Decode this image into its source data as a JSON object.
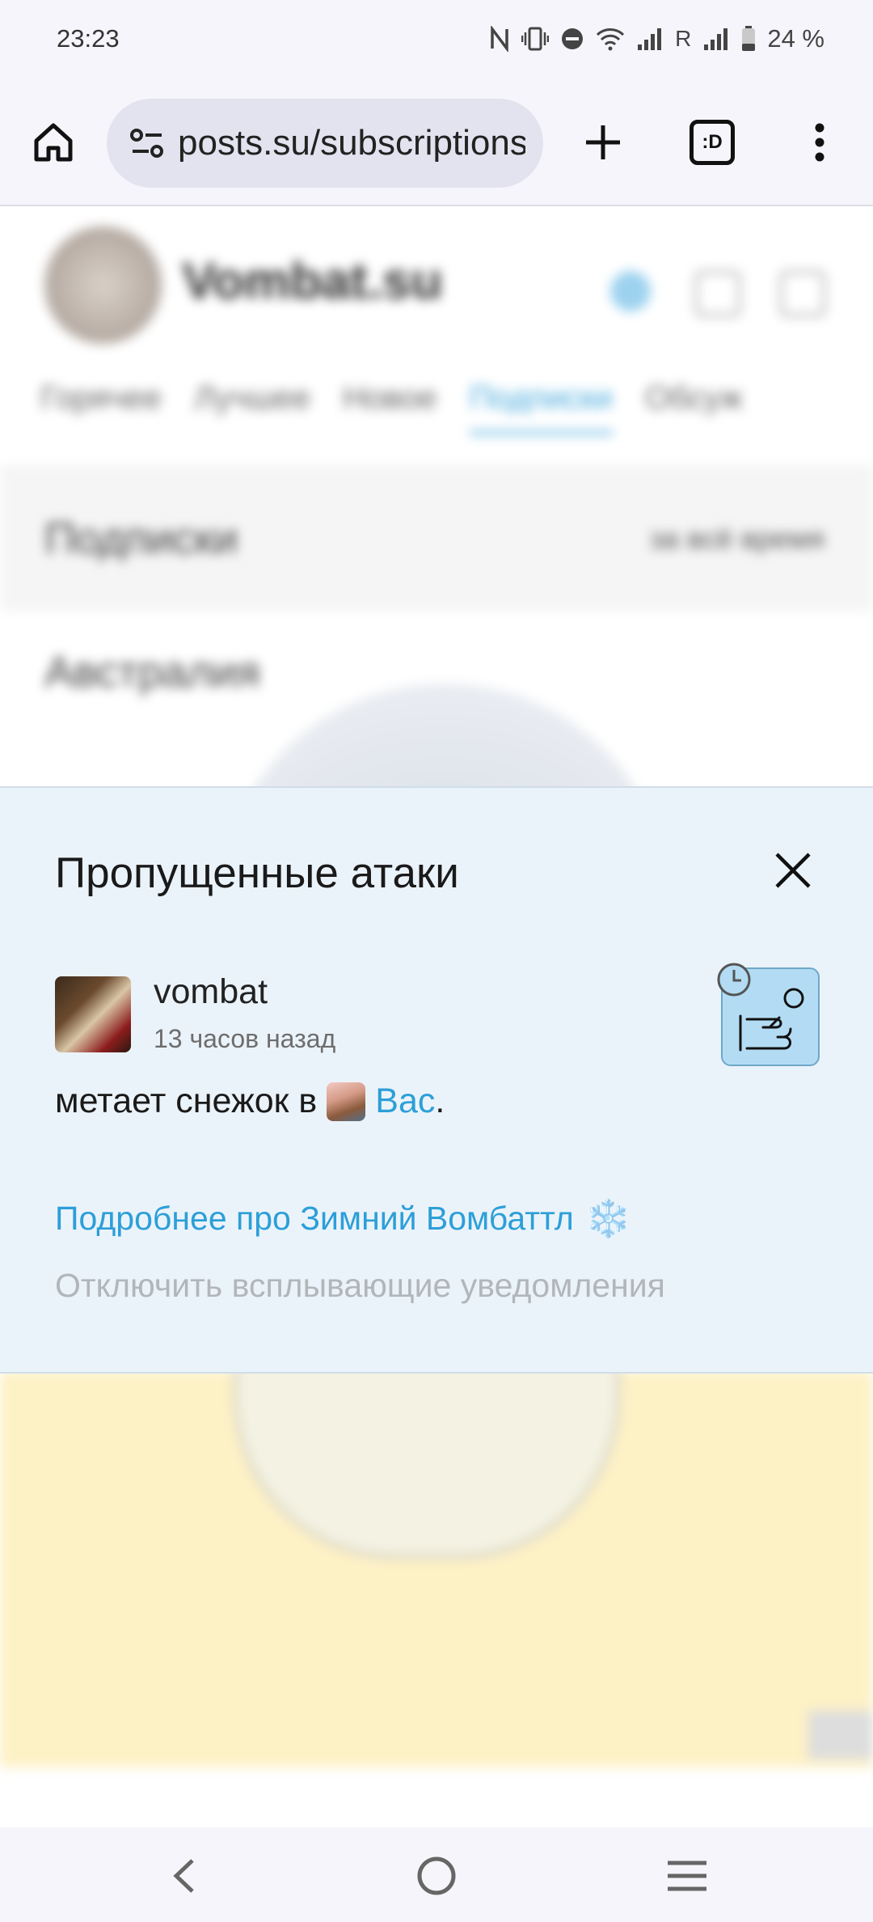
{
  "status_bar": {
    "time": "23:23",
    "roaming": "R",
    "battery": "24 %"
  },
  "browser": {
    "url": "posts.su/subscriptions",
    "tab_count": ":D"
  },
  "background_page": {
    "site_name": "Vombat.su",
    "tabs": [
      "Горячее",
      "Лучшее",
      "Новое",
      "Подписки",
      "Обсуж"
    ],
    "section_title": "Подписки",
    "section_filter": "за всё время",
    "post_title": "Австралия"
  },
  "popup": {
    "title": "Пропущенные атаки",
    "username": "vombat",
    "time_ago": "13 часов назад",
    "message_prefix": "метает снежок в",
    "message_target": "Вас",
    "message_suffix": ".",
    "more_link": "Подробнее про Зимний Вомбаттл",
    "more_link_icon": "❄️",
    "disable_link": "Отключить всплывающие уведомления"
  },
  "colors": {
    "popup_bg": "#ebf3fa",
    "link": "#2c9fd8",
    "muted_link": "#b1b6bb",
    "attack_icon_bg": "#b3dcf4"
  }
}
